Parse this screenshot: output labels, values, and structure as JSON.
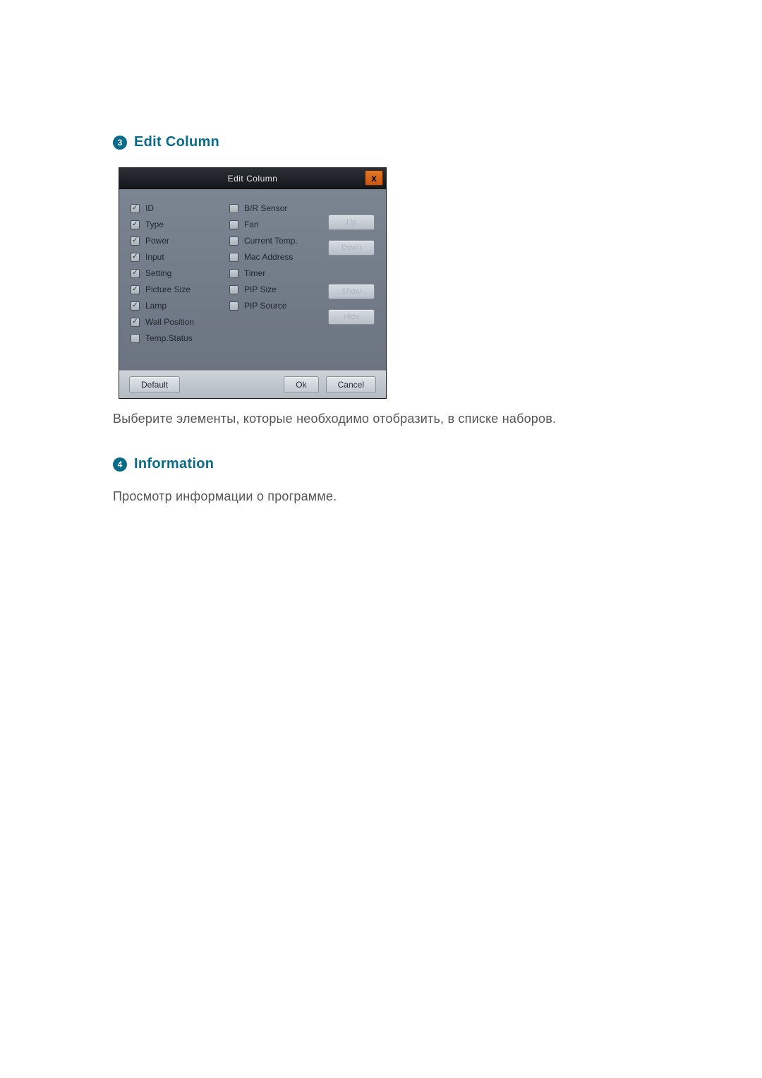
{
  "section3": {
    "number": "3",
    "title": "Edit Column",
    "description": "Выберите элементы, которые необходимо отобразить, в списке наборов."
  },
  "section4": {
    "number": "4",
    "title": "Information",
    "description": "Просмотр информации о программе."
  },
  "dialog": {
    "title": "Edit Column",
    "close": "x",
    "left_items": [
      {
        "label": "ID",
        "checked": true
      },
      {
        "label": "Type",
        "checked": true
      },
      {
        "label": "Power",
        "checked": true
      },
      {
        "label": "Input",
        "checked": true
      },
      {
        "label": "Setting",
        "checked": true
      },
      {
        "label": "Picture Size",
        "checked": true
      },
      {
        "label": "Lamp",
        "checked": true
      },
      {
        "label": "Wall Position",
        "checked": true
      },
      {
        "label": "Temp.Status",
        "checked": false
      }
    ],
    "right_items": [
      {
        "label": "B/R Sensor",
        "checked": false
      },
      {
        "label": "Fan",
        "checked": false
      },
      {
        "label": "Current Temp.",
        "checked": false
      },
      {
        "label": "Mac Address",
        "checked": false
      },
      {
        "label": "Timer",
        "checked": false
      },
      {
        "label": "PIP Size",
        "checked": false
      },
      {
        "label": "PIP Source",
        "checked": false
      }
    ],
    "buttons": {
      "up": "Up",
      "down": "Down",
      "show": "Show",
      "hide": "Hide",
      "default": "Default",
      "ok": "Ok",
      "cancel": "Cancel"
    }
  }
}
